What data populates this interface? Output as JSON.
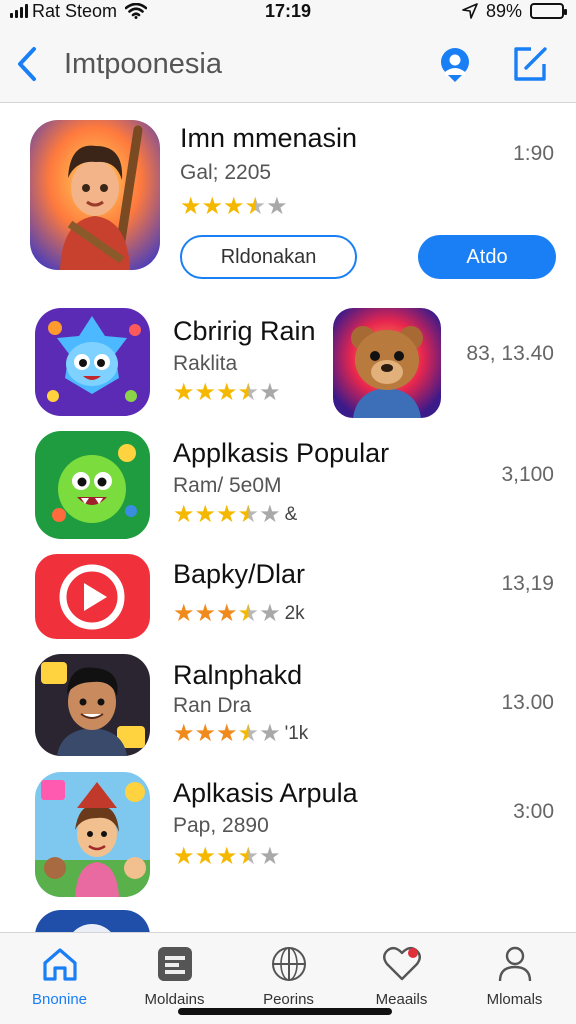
{
  "status_bar": {
    "carrier": "Rat Steom",
    "time": "17:19",
    "battery_percent": "89%",
    "battery_level": 0.89
  },
  "nav": {
    "back_icon": "chevron-left-icon",
    "title": "Imtpoonesia",
    "right_icons": [
      "profile-icon",
      "compose-icon"
    ]
  },
  "featured": {
    "name": "Imn mmenasin",
    "subtitle": "Gal; 2205",
    "rating": 3.5,
    "time": "1:90",
    "secondary_button": "Rldonakan",
    "primary_button": "Atdo"
  },
  "apps": [
    {
      "name": "Cbririg Rain",
      "subtitle": "Raklita",
      "rating": 3.5,
      "rating_text": "",
      "time": "83, 13.40"
    },
    {
      "name": "Applkasis Popular",
      "subtitle": "Ram/ 5e0M",
      "rating": 3.5,
      "rating_text": "&",
      "time": "3,100"
    },
    {
      "name": "Bapky/Dlar",
      "subtitle": "",
      "rating": 3.5,
      "rating_text": "2k",
      "time": "13,19"
    },
    {
      "name": "Ralnphakd",
      "subtitle": "Ran Dra",
      "rating": 3.5,
      "rating_text": "'1k",
      "time": "13.00"
    },
    {
      "name": "Aplkasis Arpula",
      "subtitle": "Pap, 2890",
      "rating": 3.5,
      "rating_text": "",
      "time": "3:00"
    }
  ],
  "tabs": [
    {
      "label": "Bnonine",
      "icon": "home-icon",
      "active": true
    },
    {
      "label": "Moldains",
      "icon": "apps-icon",
      "active": false
    },
    {
      "label": "Peorins",
      "icon": "globe-icon",
      "active": false
    },
    {
      "label": "Meaails",
      "icon": "heart-icon",
      "active": false
    },
    {
      "label": "Mlomals",
      "icon": "person-icon",
      "active": false
    }
  ],
  "colors": {
    "accent": "#1a7ff5",
    "star": "#f5b800",
    "star_orange": "#f08a1c"
  }
}
